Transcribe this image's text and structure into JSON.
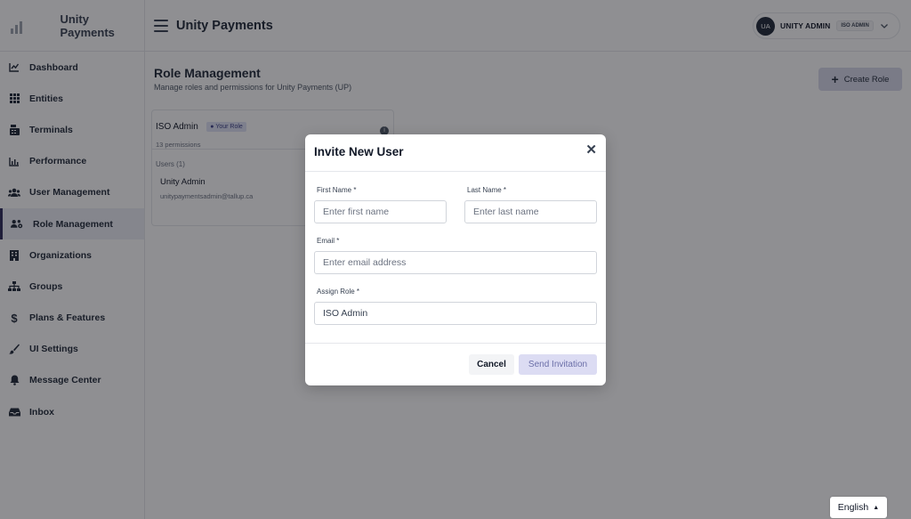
{
  "app": {
    "brand_name": "Unity Payments",
    "top_title": "Unity Payments"
  },
  "user": {
    "initials": "UA",
    "name": "UNITY ADMIN",
    "badge": "ISO ADMIN"
  },
  "sidebar": {
    "items": [
      {
        "label": "Dashboard",
        "icon": "chart-line-icon"
      },
      {
        "label": "Entities",
        "icon": "grid-icon"
      },
      {
        "label": "Terminals",
        "icon": "terminal-icon"
      },
      {
        "label": "Performance",
        "icon": "bar-chart-icon"
      },
      {
        "label": "User Management",
        "icon": "users-icon"
      },
      {
        "label": "Role Management",
        "icon": "users-gear-icon",
        "active": true
      },
      {
        "label": "Organizations",
        "icon": "building-icon"
      },
      {
        "label": "Groups",
        "icon": "sitemap-icon"
      },
      {
        "label": "Plans & Features",
        "icon": "dollar-icon"
      },
      {
        "label": "UI Settings",
        "icon": "brush-icon"
      },
      {
        "label": "Message Center",
        "icon": "bell-icon"
      },
      {
        "label": "Inbox",
        "icon": "inbox-icon"
      }
    ]
  },
  "page": {
    "title": "Role Management",
    "subtitle": "Manage roles and permissions for Unity Payments (UP)",
    "create_label": "Create Role"
  },
  "role_card": {
    "name": "ISO Admin",
    "badge": "Your Role",
    "permissions": "13 permissions",
    "users_count": "Users (1)",
    "user_name": "Unity Admin",
    "user_email": "unitypaymentsadmin@tallup.ca"
  },
  "language": {
    "label": "English"
  },
  "modal": {
    "title": "Invite New User",
    "first_name_label": "First Name *",
    "first_name_placeholder": "Enter first name",
    "last_name_label": "Last Name *",
    "last_name_placeholder": "Enter last name",
    "email_label": "Email *",
    "email_placeholder": "Enter email address",
    "role_label": "Assign Role *",
    "role_value": "ISO Admin",
    "cancel_label": "Cancel",
    "send_label": "Send Invitation"
  },
  "colors": {
    "accent": "#2d2a5a",
    "overlay": "#111118",
    "primary_disabled": "#dcdcf3"
  }
}
